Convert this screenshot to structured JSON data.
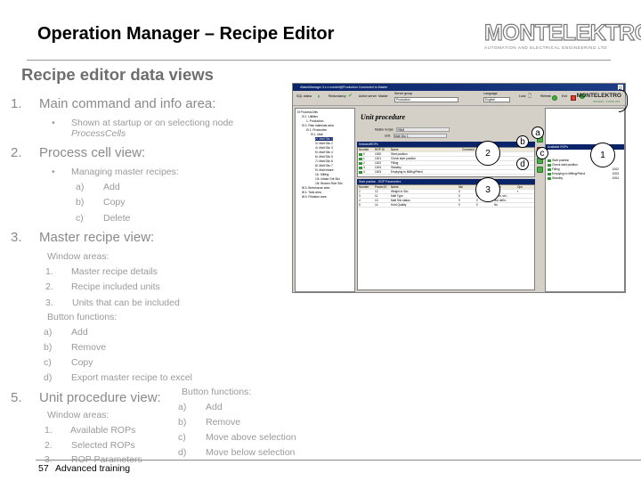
{
  "header": {
    "title": "Operation Manager – Recipe Editor",
    "logo_brand": "MONTELEKTRO",
    "logo_tagline": "AUTOMATION AND ELECTRICAL ENGINEERING LTD",
    "section_title": "Recipe editor data views"
  },
  "outline": {
    "item1": {
      "num": "1.",
      "label": "Main command and info area:",
      "bullet": "Shown at startup or on selectiong node",
      "bullet_italic": "ProcessCells"
    },
    "item2": {
      "num": "2.",
      "label": "Process cell view:",
      "bullet": "Managing master recipes:",
      "subs": [
        {
          "m": "a)",
          "t": "Add"
        },
        {
          "m": "b)",
          "t": "Copy"
        },
        {
          "m": "c)",
          "t": "Delete"
        }
      ]
    },
    "item3": {
      "num": "3.",
      "label": "Master recipe view:",
      "window_areas_label": "Window areas:",
      "areas": [
        {
          "m": "1.",
          "t": "Master recipe details"
        },
        {
          "m": "2.",
          "t": "Recipe included units"
        },
        {
          "m": "3.",
          "t": "Units that can be included"
        }
      ],
      "button_functions_label": "Button functions:",
      "buttons": [
        {
          "m": "a)",
          "t": "Add"
        },
        {
          "m": "b)",
          "t": "Remove"
        },
        {
          "m": "c)",
          "t": "Copy"
        },
        {
          "m": "d)",
          "t": "Export master recipe to excel"
        }
      ]
    },
    "item5": {
      "num": "5.",
      "label": "Unit procedure view:",
      "window_areas_label": "Window areas:",
      "areas": [
        {
          "m": "1.",
          "t": "Available ROPs"
        },
        {
          "m": "2.",
          "t": "Selected ROPs"
        },
        {
          "m": "3.",
          "t": "ROP Parameters"
        }
      ],
      "button_functions_label": "Button functions:",
      "buttons": [
        {
          "m": "a)",
          "t": "Add"
        },
        {
          "m": "b)",
          "t": "Remove"
        },
        {
          "m": "c)",
          "t": "Move above selection"
        },
        {
          "m": "d)",
          "t": "Move below selection"
        }
      ]
    }
  },
  "footer": {
    "page": "57",
    "text": "Advanced training"
  },
  "app": {
    "window_title": "•BatchManager 3.x.x  monteli@Production  Connected to Master",
    "toolbar": {
      "sql_status": "SQL status",
      "redundancy": "Redundancy",
      "active_server": "Active server",
      "active_server_value": "Master",
      "server_group_label": "Server group",
      "server_group_value": "Production",
      "language_label": "Language",
      "language_value": "English",
      "lock": "Lock",
      "refresh": "Refresh",
      "exit": "Exit",
      "logo": "MONTELEKTRO",
      "datetime": "8/1/2016 - 2:00:01 PM"
    },
    "tree": [
      {
        "t": "⊟ ProcessCells",
        "lvl": 0
      },
      {
        "t": "⊟ 1. Utilities",
        "lvl": 1
      },
      {
        "t": "1. Production",
        "lvl": 2
      },
      {
        "t": "⊟ 2. Raw materials area",
        "lvl": 1
      },
      {
        "t": "⊟ 1. Production",
        "lvl": 2
      },
      {
        "t": "⊟ 1. Malt",
        "lvl": 3
      },
      {
        "t": "2i. Malt Silo 1",
        "lvl": 4,
        "sel": true
      },
      {
        "t": "3i. Malt Silo 2",
        "lvl": 4
      },
      {
        "t": "4i. Malt Silo 3",
        "lvl": 4
      },
      {
        "t": "5i. Malt Silo 4",
        "lvl": 4
      },
      {
        "t": "6i. Malt Silo 5",
        "lvl": 4
      },
      {
        "t": "7i. Malt Silo 6",
        "lvl": 4
      },
      {
        "t": "8i. Malt Silo 7",
        "lvl": 4
      },
      {
        "t": "9i. Malt Intake",
        "lvl": 4
      },
      {
        "t": "11i. Milling",
        "lvl": 4
      },
      {
        "t": "13i. Intake Grit Silo",
        "lvl": 4
      },
      {
        "t": "15i. Broken Rice Silo",
        "lvl": 4
      },
      {
        "t": "⊞ 3. Brewhouse area",
        "lvl": 1
      },
      {
        "t": "⊞ 4. Tank area",
        "lvl": 1
      },
      {
        "t": "⊞ 5. Filtration area",
        "lvl": 1
      }
    ],
    "unit_procedure": {
      "heading": "Unit procedure",
      "master_recipe_label": "Master recipe:",
      "master_recipe_value": "RNM",
      "unit_label": "Unit:",
      "unit_value": "Malt Silo 1"
    },
    "selected_rops": {
      "title": "SelectedROPs",
      "columns": [
        "Number",
        "ROP ID",
        "Name",
        "Comment"
      ],
      "rows": [
        [
          "0",
          "1000",
          "Start position",
          ""
        ],
        [
          "1",
          "1001",
          "Check start position",
          ""
        ],
        [
          "2",
          "1002",
          "Filling",
          ""
        ],
        [
          "3",
          "1004",
          "Standby",
          ""
        ],
        [
          "4",
          "1003",
          "Emptying to Milling/Petrol",
          ""
        ]
      ]
    },
    "rop_parameters": {
      "title": "Start position - ROP Parameters",
      "columns": [
        "Number",
        "Param ID",
        "Name",
        "Min",
        "Max",
        "Value",
        "Ops"
      ],
      "rows": [
        [
          "2",
          "12",
          "Weight in Silo",
          "0",
          "0",
          "",
          "t"
        ],
        [
          "3",
          "11",
          "Malt Type",
          "0",
          "0",
          "None, sel..",
          ""
        ],
        [
          "4",
          "13",
          "Malt Silo status",
          "0",
          "0",
          "Not defin..",
          ""
        ],
        [
          "5",
          "14",
          "Hold Quality",
          "0",
          "0",
          "No",
          ""
        ]
      ]
    },
    "available_rops": {
      "title": "Available ROPs",
      "items": [
        {
          "name": "Start position",
          "id": ""
        },
        {
          "name": "Check start position",
          "id": ""
        },
        {
          "name": "Filling",
          "id": "1002"
        },
        {
          "name": "Emptying to Milling/Petrol",
          "id": "1003"
        },
        {
          "name": "Standby",
          "id": "1004"
        }
      ]
    }
  },
  "callouts": {
    "c1": "1",
    "c2": "2",
    "c3": "3",
    "a": "a",
    "b": "b",
    "c": "c",
    "d": "d"
  }
}
